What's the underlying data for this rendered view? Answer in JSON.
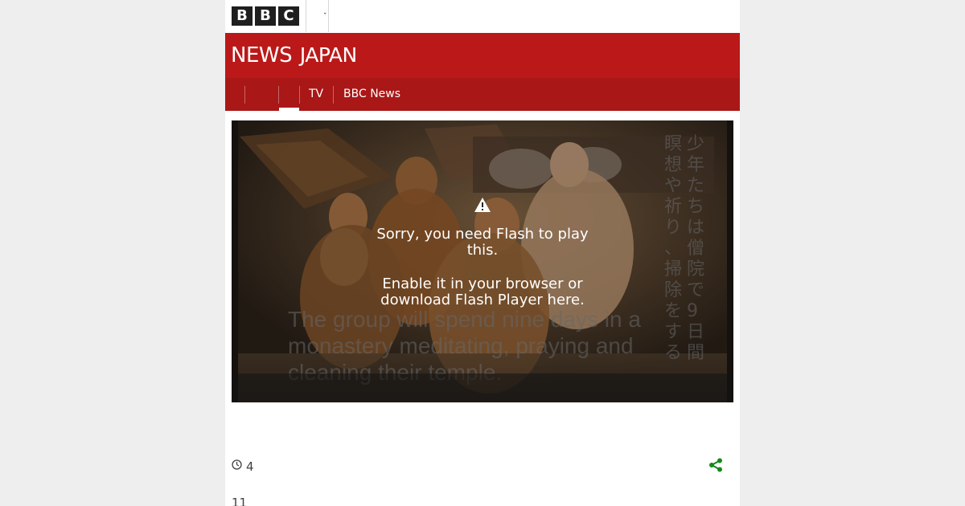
{
  "bbc": {
    "logo_letters": [
      "B",
      "B",
      "C"
    ],
    "menu_chevron": "ˇ"
  },
  "header": {
    "news_word": "NEWS",
    "edition_word": "JAPAN",
    "brand_color": "#bb1919"
  },
  "nav": {
    "items": [
      {
        "label": ""
      },
      {
        "label": ""
      },
      {
        "label": "",
        "active": true
      },
      {
        "label": "TV"
      },
      {
        "label": "BBC News"
      }
    ]
  },
  "video": {
    "warning_icon": "warning-triangle-icon",
    "message_line1": "Sorry, you need Flash to play this.",
    "message_line2": "Enable it in your browser or download Flash Player here.",
    "caption_en": "The group will spend nine days in a monastery meditating, praying and cleaning their temple.",
    "caption_jp": "少年たちは僧院で9日間 瞑想や祈り、掃除をする"
  },
  "meta": {
    "clock_icon": "clock-icon",
    "time_ago": "4",
    "share_icon": "share-icon",
    "share_color": "#138a1a",
    "date_snippet": "11"
  }
}
